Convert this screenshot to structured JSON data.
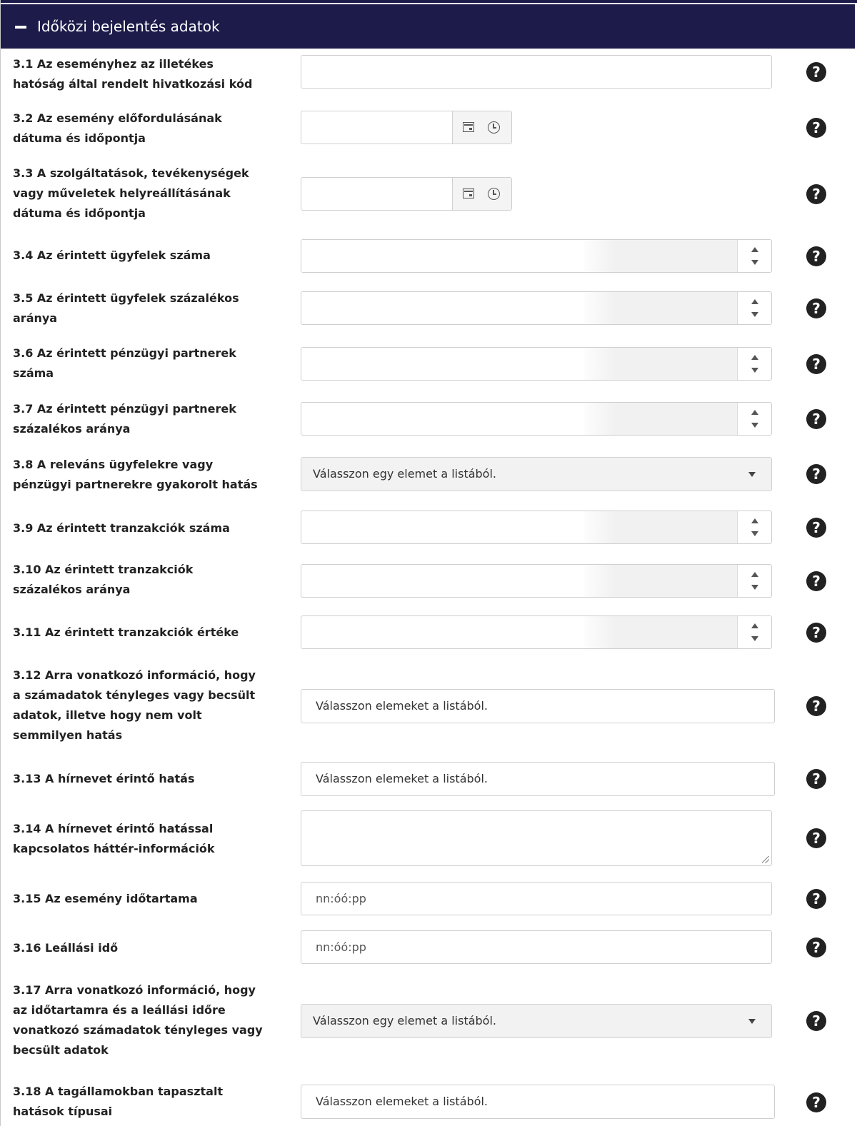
{
  "header": {
    "title": "Időközi bejelentés adatok"
  },
  "help_glyph": "?",
  "fields": [
    {
      "label": [
        "3.1 Az eseményhez az illetékes",
        "hatóság által rendelt hivatkozási kód"
      ]
    },
    {
      "label": [
        "3.2 Az esemény előfordulásának",
        "dátuma és időpontja"
      ]
    },
    {
      "label": [
        "3.3 A szolgáltatások, tevékenységek",
        "vagy műveletek helyreállításának",
        "dátuma és időpontja"
      ]
    },
    {
      "label": [
        "3.4 Az érintett ügyfelek száma"
      ]
    },
    {
      "label": [
        "3.5 Az érintett ügyfelek százalékos",
        "aránya"
      ]
    },
    {
      "label": [
        "3.6 Az érintett pénzügyi partnerek",
        "száma"
      ]
    },
    {
      "label": [
        "3.7 Az érintett pénzügyi partnerek",
        "százalékos aránya"
      ]
    },
    {
      "label": [
        "3.8 A releváns ügyfelekre vagy",
        "pénzügyi partnerekre gyakorolt hatás"
      ],
      "value": "Válasszon egy elemet a listából."
    },
    {
      "label": [
        "3.9 Az érintett tranzakciók száma"
      ]
    },
    {
      "label": [
        "3.10 Az érintett tranzakciók",
        "százalékos aránya"
      ]
    },
    {
      "label": [
        "3.11 Az érintett tranzakciók értéke"
      ]
    },
    {
      "label": [
        "3.12 Arra vonatkozó információ, hogy",
        "a számadatok tényleges vagy becsült",
        "adatok, illetve hogy nem volt",
        "semmilyen hatás"
      ],
      "value": "Válasszon elemeket a listából."
    },
    {
      "label": [
        "3.13 A hírnevet érintő hatás"
      ],
      "value": "Válasszon elemeket a listából."
    },
    {
      "label": [
        "3.14 A hírnevet érintő hatással",
        "kapcsolatos háttér-információk"
      ]
    },
    {
      "label": [
        "3.15 Az esemény időtartama"
      ],
      "placeholder": "nn:óó:pp"
    },
    {
      "label": [
        "3.16 Leállási idő"
      ],
      "placeholder": "nn:óó:pp"
    },
    {
      "label": [
        "3.17 Arra vonatkozó információ, hogy",
        "az időtartamra és a leállási időre",
        "vonatkozó számadatok tényleges vagy",
        "becsült adatok"
      ],
      "value": "Válasszon egy elemet a listából."
    },
    {
      "label": [
        "3.18 A tagállamokban tapasztalt",
        "hatások típusai"
      ],
      "value": "Válasszon elemeket a listából."
    }
  ]
}
